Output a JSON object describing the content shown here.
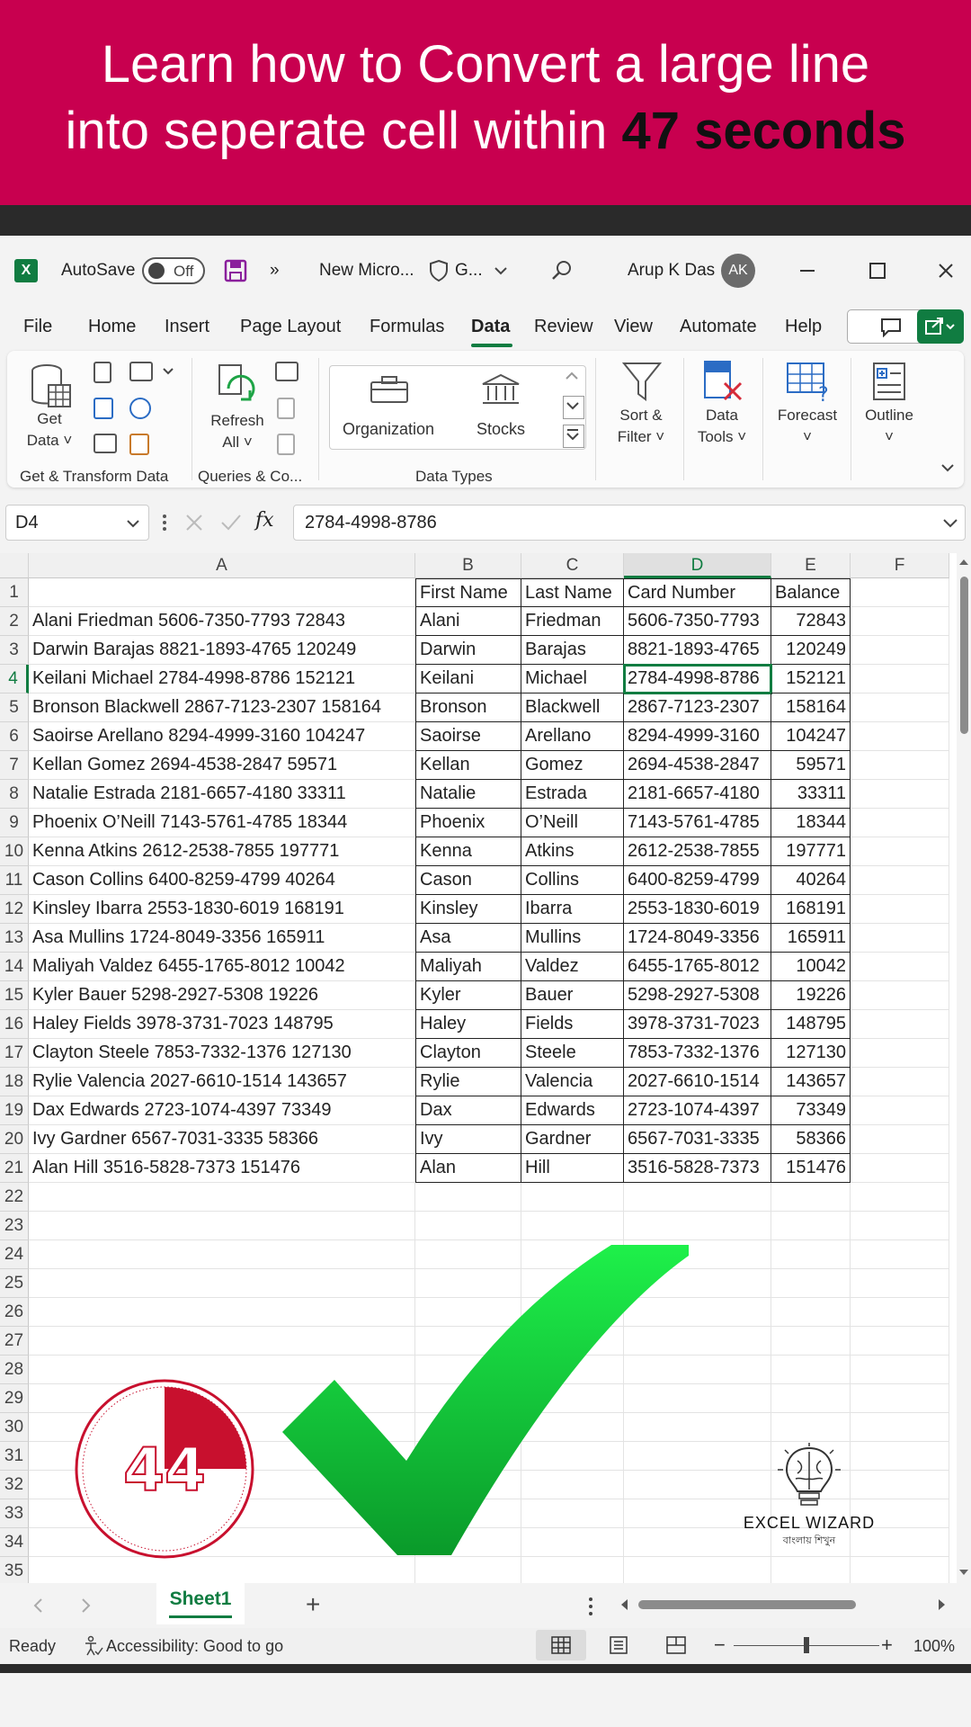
{
  "banner": {
    "line1": "Learn how to Convert a large line",
    "line2_prefix": "into seperate cell within ",
    "line2_bold": "47 seconds"
  },
  "titlebar": {
    "autosave_label": "AutoSave",
    "autosave_state": "Off",
    "more": "»",
    "doc_title": "New Micro...",
    "sensitivity": "G...",
    "user_name": "Arup K Das",
    "user_initials": "AK"
  },
  "menu": [
    "File",
    "Home",
    "Insert",
    "Page Layout",
    "Formulas",
    "Data",
    "Review",
    "View",
    "Automate",
    "Help"
  ],
  "menu_active": "Data",
  "ribbon": {
    "get_data_l1": "Get",
    "get_data_l2": "Data ˅",
    "refresh_l1": "Refresh",
    "refresh_l2": "All ˅",
    "organization": "Organization",
    "stocks": "Stocks",
    "sort_l1": "Sort &",
    "sort_l2": "Filter ˅",
    "data_tools_l1": "Data",
    "data_tools_l2": "Tools ˅",
    "forecast_l1": "Forecast",
    "forecast_l2": "˅",
    "outline_l1": "Outline",
    "outline_l2": "˅",
    "group_get": "Get & Transform Data",
    "group_queries": "Queries & Co...",
    "group_types": "Data Types"
  },
  "formula_bar": {
    "name_box": "D4",
    "fx": "fx",
    "value": "2784-4998-8786"
  },
  "columns": [
    "A",
    "B",
    "C",
    "D",
    "E",
    "F"
  ],
  "headers": {
    "b": "First Name",
    "c": "Last Name",
    "d": "Card Number",
    "e": "Balance"
  },
  "rows": [
    [
      "Alani Friedman 5606-7350-7793 72843",
      "Alani",
      "Friedman",
      "5606-7350-7793",
      "72843"
    ],
    [
      "Darwin Barajas 8821-1893-4765 120249",
      "Darwin",
      "Barajas",
      "8821-1893-4765",
      "120249"
    ],
    [
      "Keilani Michael 2784-4998-8786 152121",
      "Keilani",
      "Michael",
      "2784-4998-8786",
      "152121"
    ],
    [
      "Bronson Blackwell 2867-7123-2307 158164",
      "Bronson",
      "Blackwell",
      "2867-7123-2307",
      "158164"
    ],
    [
      "Saoirse Arellano 8294-4999-3160 104247",
      "Saoirse",
      "Arellano",
      "8294-4999-3160",
      "104247"
    ],
    [
      "Kellan Gomez 2694-4538-2847 59571",
      "Kellan",
      "Gomez",
      "2694-4538-2847",
      "59571"
    ],
    [
      "Natalie Estrada 2181-6657-4180 33311",
      "Natalie",
      "Estrada",
      "2181-6657-4180",
      "33311"
    ],
    [
      "Phoenix O’Neill 7143-5761-4785 18344",
      "Phoenix",
      "O’Neill",
      "7143-5761-4785",
      "18344"
    ],
    [
      "Kenna Atkins 2612-2538-7855 197771",
      "Kenna",
      "Atkins",
      "2612-2538-7855",
      "197771"
    ],
    [
      "Cason Collins 6400-8259-4799 40264",
      "Cason",
      "Collins",
      "6400-8259-4799",
      "40264"
    ],
    [
      "Kinsley Ibarra 2553-1830-6019 168191",
      "Kinsley",
      "Ibarra",
      "2553-1830-6019",
      "168191"
    ],
    [
      "Asa Mullins 1724-8049-3356 165911",
      "Asa",
      "Mullins",
      "1724-8049-3356",
      "165911"
    ],
    [
      "Maliyah Valdez 6455-1765-8012 10042",
      "Maliyah",
      "Valdez",
      "6455-1765-8012",
      "10042"
    ],
    [
      "Kyler Bauer 5298-2927-5308 19226",
      "Kyler",
      "Bauer",
      "5298-2927-5308",
      "19226"
    ],
    [
      "Haley Fields 3978-3731-7023 148795",
      "Haley",
      "Fields",
      "3978-3731-7023",
      "148795"
    ],
    [
      "Clayton Steele 7853-7332-1376 127130",
      "Clayton",
      "Steele",
      "7853-7332-1376",
      "127130"
    ],
    [
      "Rylie Valencia 2027-6610-1514 143657",
      "Rylie",
      "Valencia",
      "2027-6610-1514",
      "143657"
    ],
    [
      "Dax Edwards 2723-1074-4397 73349",
      "Dax",
      "Edwards",
      "2723-1074-4397",
      "73349"
    ],
    [
      "Ivy Gardner 6567-7031-3335 58366",
      "Ivy",
      "Gardner",
      "6567-7031-3335",
      "58366"
    ],
    [
      "Alan Hill 3516-5828-7373 151476",
      "Alan",
      "Hill",
      "3516-5828-7373",
      "151476"
    ]
  ],
  "row_numbers": [
    "1",
    "2",
    "3",
    "4",
    "5",
    "6",
    "7",
    "8",
    "9",
    "10",
    "11",
    "12",
    "13",
    "14",
    "15",
    "16",
    "17",
    "18",
    "19",
    "20",
    "21",
    "22",
    "23",
    "24",
    "25",
    "26",
    "27",
    "28",
    "29",
    "30",
    "31",
    "32",
    "33",
    "34",
    "35"
  ],
  "selected_cell": "D4",
  "timer": {
    "value": "44",
    "progress": 0.75
  },
  "logo": {
    "name": "EXCEL WIZARD",
    "tagline": "বাংলায় শিখুন"
  },
  "sheet_tab": "Sheet1",
  "add_sheet": "+",
  "status": {
    "ready": "Ready",
    "accessibility": "Accessibility: Good to go",
    "zoom": "100%",
    "minus": "−",
    "plus": "+"
  },
  "colors": {
    "banner": "#c8004f",
    "excel_green": "#107c41",
    "check_green": "#1ec23a",
    "timer_red": "#c8102e"
  }
}
